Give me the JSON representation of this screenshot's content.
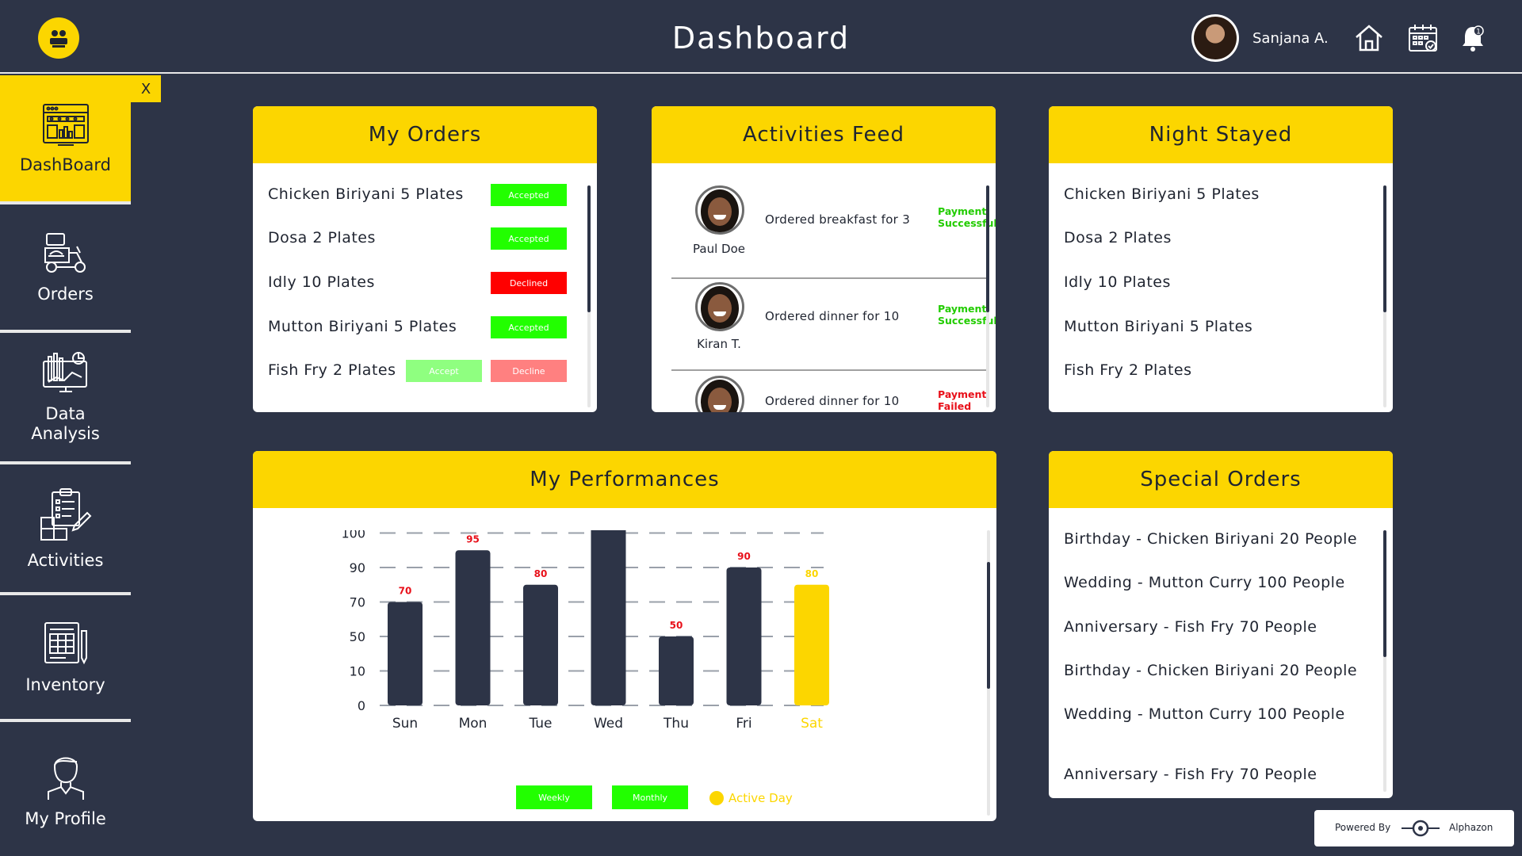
{
  "header": {
    "title": "Dashboard",
    "user_name": "Sanjana A.",
    "icons": [
      "logo-icon",
      "home-icon",
      "calendar-icon",
      "notification-bell-icon"
    ]
  },
  "sidebar": {
    "close_label": "X",
    "items": [
      {
        "label": "DashBoard",
        "icon": "dashboard-icon",
        "active": true
      },
      {
        "label": "Orders",
        "icon": "delivery-scooter-icon",
        "active": false
      },
      {
        "label": "Data\nAnalysis",
        "icon": "data-analysis-icon",
        "active": false
      },
      {
        "label": "Activities",
        "icon": "clipboard-icon",
        "active": false
      },
      {
        "label": "Inventory",
        "icon": "inventory-icon",
        "active": false
      },
      {
        "label": "My Profile",
        "icon": "profile-icon",
        "active": false
      }
    ]
  },
  "my_orders": {
    "title": "My Orders",
    "rows": [
      {
        "item": "Chicken Biriyani 5 Plates",
        "status": "Accepted"
      },
      {
        "item": "Dosa 2 Plates",
        "status": "Accepted"
      },
      {
        "item": "Idly 10 Plates",
        "status": "Declined"
      },
      {
        "item": "Mutton Biriyani 5 Plates",
        "status": "Accepted"
      },
      {
        "item": "Fish Fry 2 Plates",
        "accept_label": "Accept",
        "decline_label": "Decline"
      }
    ]
  },
  "activities_feed": {
    "title": "Activities Feed",
    "items": [
      {
        "name": "Paul Doe",
        "text": "Ordered breakfast for 3",
        "status": "Payment\nSuccessful"
      },
      {
        "name": "Kiran T.",
        "text": "Ordered dinner for 10",
        "status": "Payment\nSuccessful"
      },
      {
        "name": "",
        "text": "Ordered dinner for 10",
        "status": "Payment\nFailed"
      }
    ]
  },
  "night_stayed": {
    "title": "Night Stayed",
    "rows": [
      "Chicken Biriyani 5 Plates",
      "Dosa 2 Plates",
      "Idly 10 Plates",
      "Mutton Biriyani 5 Plates",
      "Fish Fry 2 Plates"
    ]
  },
  "performances": {
    "title": "My Performances",
    "weekly_label": "Weekly",
    "monthly_label": "Monthly",
    "active_day_label": "Active Day"
  },
  "chart_data": {
    "type": "bar",
    "title": "My Performances",
    "categories": [
      "Sun",
      "Mon",
      "Tue",
      "Wed",
      "Thu",
      "Fri",
      "Sat"
    ],
    "values": [
      70,
      95,
      80,
      110,
      50,
      90,
      80
    ],
    "y_ticks": [
      "0",
      "10",
      "50",
      "70",
      "90",
      "100"
    ],
    "active_category": "Sat",
    "grid": true,
    "colors": {
      "bar": "#2d3447",
      "active": "#fcd600",
      "value_label": "#e8101a"
    }
  },
  "special_orders": {
    "title": "Special Orders",
    "rows": [
      "Birthday - Chicken Biriyani 20 People",
      "Wedding - Mutton Curry 100 People",
      "Anniversary - Fish Fry 70 People",
      "Birthday - Chicken Biriyani 20 People",
      "Wedding - Mutton Curry 100 People",
      "Anniversary - Fish Fry 70 People"
    ]
  },
  "footer": {
    "powered_by": "Powered By",
    "brand": "Alphazon"
  },
  "colors": {
    "background": "#2d3447",
    "accent": "#fcd600",
    "accepted": "#22ff00",
    "declined": "#ff0000",
    "success_text": "#22cc00",
    "failed_text": "#e8101a"
  }
}
